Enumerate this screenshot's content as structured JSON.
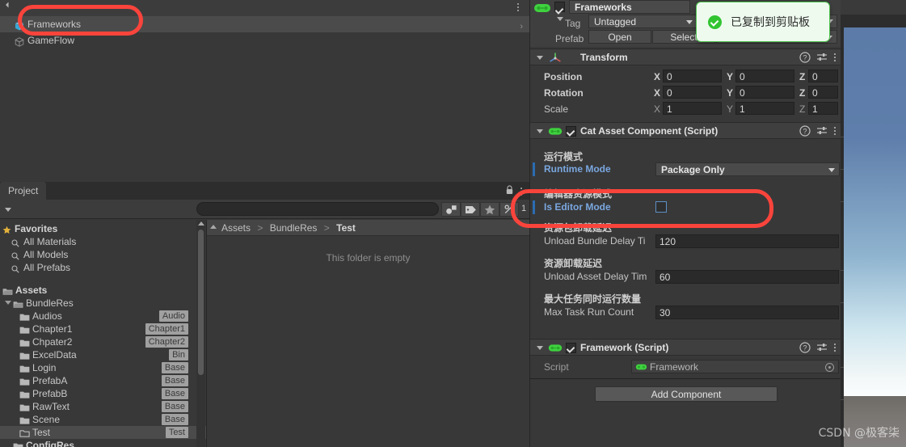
{
  "hierarchy": {
    "scene_row": "",
    "items": [
      {
        "label": "Frameworks",
        "icon": "prefab-cube-icon",
        "selected": true
      },
      {
        "label": "GameFlow",
        "icon": "prefab-cube-icon",
        "selected": false
      }
    ],
    "menu_icon": "kebab-menu-icon",
    "row_chevron": "chevron-right-icon"
  },
  "project": {
    "tab_label": "Project",
    "lock_icon": "lock-icon",
    "menu_icon": "kebab-menu-icon",
    "search": {
      "value": "",
      "placeholder": "",
      "icon": "search-icon"
    },
    "toolbar_icons": [
      "asset-type-filter-icon",
      "label-filter-icon",
      "favorite-star-icon",
      "percent-filter-icon"
    ],
    "item_count": "1",
    "favorites": {
      "header": "Favorites",
      "star_icon": "favorite-star-icon",
      "items": [
        {
          "label": "All Materials",
          "icon": "search-icon"
        },
        {
          "label": "All Models",
          "icon": "search-icon"
        },
        {
          "label": "All Prefabs",
          "icon": "search-icon"
        }
      ]
    },
    "assets": {
      "header": "Assets",
      "folder_icon": "folder-open-icon",
      "children": [
        {
          "label": "BundleRes",
          "badge": "",
          "depth": 1,
          "expanded": true,
          "selected": false
        },
        {
          "label": "Audios",
          "badge": "Audio",
          "depth": 2,
          "selected": false
        },
        {
          "label": "Chapter1",
          "badge": "Chapter1",
          "depth": 2,
          "selected": false
        },
        {
          "label": "Chpater2",
          "badge": "Chapter2",
          "depth": 2,
          "selected": false
        },
        {
          "label": "ExcelData",
          "badge": "Bin",
          "depth": 2,
          "selected": false
        },
        {
          "label": "Login",
          "badge": "Base",
          "depth": 2,
          "selected": false
        },
        {
          "label": "PrefabA",
          "badge": "Base",
          "depth": 2,
          "selected": false
        },
        {
          "label": "PrefabB",
          "badge": "Base",
          "depth": 2,
          "selected": false
        },
        {
          "label": "RawText",
          "badge": "Base",
          "depth": 2,
          "selected": false
        },
        {
          "label": "Scene",
          "badge": "Base",
          "depth": 2,
          "selected": false
        },
        {
          "label": "Test",
          "badge": "Test",
          "depth": 2,
          "selected": true
        },
        {
          "label": "ConfigRes",
          "badge": "",
          "depth": 1,
          "selected": false
        }
      ]
    },
    "breadcrumb": {
      "parts": [
        "Assets",
        "BundleRes",
        "Test"
      ],
      "separator": ">",
      "up_icon": "triangle-up-icon"
    },
    "empty_message": "This folder is empty"
  },
  "inspector": {
    "gameobject": {
      "name": "Frameworks",
      "enabled": true,
      "icon": "gameobject-prefab-icon",
      "static_arrow_icon": "chevron-down-icon",
      "tag_label": "Tag",
      "tag_value": "Untagged",
      "layer_value": "",
      "prefab_label": "Prefab",
      "prefab_open": "Open",
      "prefab_select": "Select",
      "prefab_overrides": ""
    },
    "components": [
      {
        "title": "Transform",
        "icon": "transform-axis-icon",
        "has_checkbox": false,
        "header_icons": [
          "help-icon",
          "preset-icon",
          "kebab-menu-icon"
        ],
        "rows": [
          {
            "name": "Position",
            "bold": true,
            "axes": [
              "X",
              "Y",
              "Z"
            ],
            "values": [
              "0",
              "0",
              "0"
            ]
          },
          {
            "name": "Rotation",
            "bold": true,
            "axes": [
              "X",
              "Y",
              "Z"
            ],
            "values": [
              "0",
              "0",
              "0"
            ]
          },
          {
            "name": "Scale",
            "bold": false,
            "axes": [
              "X",
              "Y",
              "Z"
            ],
            "values": [
              "1",
              "1",
              "1"
            ]
          }
        ]
      },
      {
        "title": "Cat Asset Component (Script)",
        "icon": "script-gamepad-icon",
        "has_checkbox": true,
        "header_icons": [
          "help-icon",
          "preset-icon",
          "kebab-menu-icon"
        ],
        "fields": [
          {
            "cn_label": "运行模式",
            "en_label": "Runtime Mode",
            "type": "dropdown",
            "value": "Package Only",
            "overridden": true,
            "highlighted": false
          },
          {
            "cn_label": "编辑器资源模式",
            "en_label": "Is Editor Mode",
            "type": "checkbox",
            "value": false,
            "overridden": true,
            "highlighted": true
          },
          {
            "cn_label": "资源包卸载延迟",
            "en_label": "Unload Bundle Delay Ti",
            "type": "number",
            "value": "120",
            "overridden": false,
            "highlighted": false
          },
          {
            "cn_label": "资源卸载延迟",
            "en_label": "Unload Asset Delay Tim",
            "type": "number",
            "value": "60",
            "overridden": false,
            "highlighted": false
          },
          {
            "cn_label": "最大任务同时运行数量",
            "en_label": "Max Task Run Count",
            "type": "number",
            "value": "30",
            "overridden": false,
            "highlighted": false
          }
        ]
      },
      {
        "title": "Framework (Script)",
        "icon": "script-gamepad-icon",
        "has_checkbox": true,
        "header_icons": [
          "help-icon",
          "preset-icon",
          "kebab-menu-icon"
        ],
        "script_row": {
          "name": "Script",
          "value": "Framework",
          "icon": "script-gamepad-icon",
          "picker_icon": "target-circle-icon"
        }
      }
    ],
    "add_component_label": "Add Component"
  },
  "toast": {
    "message": "已复制到剪贴板",
    "icon": "check-circle-icon",
    "accent": "#31c431",
    "background": "#eefaee"
  },
  "annotations": [
    {
      "name": "hierarchy-frameworks-highlight",
      "color": "#f9443c"
    },
    {
      "name": "is-editor-mode-highlight",
      "color": "#f9443c"
    }
  ],
  "watermark": "CSDN @极客柒"
}
